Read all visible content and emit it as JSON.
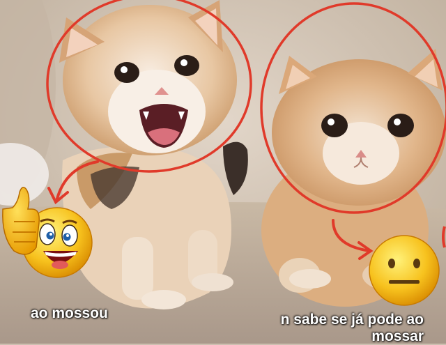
{
  "captions": {
    "left": "ao mossou",
    "right": "n sabe se já pode ao mossar"
  },
  "colors": {
    "circle_annotation": "#e03a2a",
    "fur_light": "#f1dcc4",
    "fur_orange": "#d9a878",
    "carpet": "#cbbba7",
    "background": "#d8cbbd"
  },
  "icons": {
    "left": "laughing-thumbs-up-emoji-icon",
    "right": "neutral-face-emoji-icon"
  }
}
